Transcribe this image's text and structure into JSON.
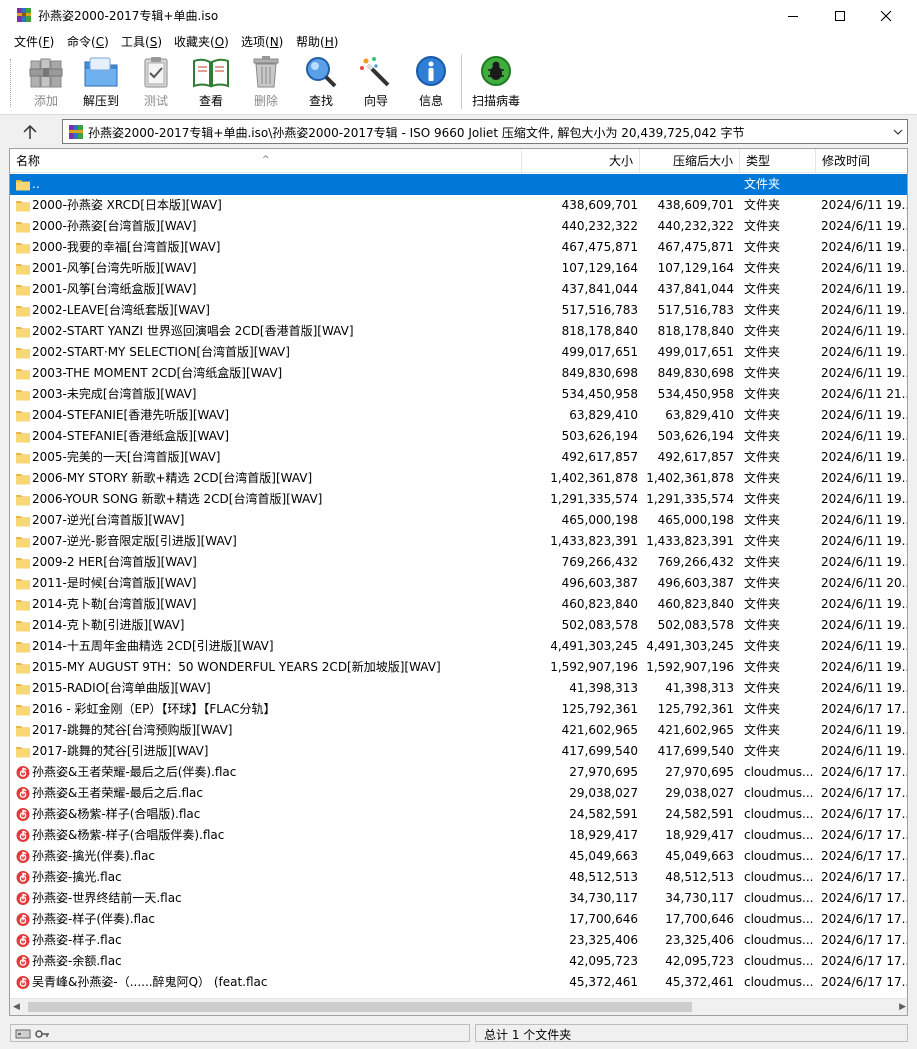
{
  "window": {
    "title": "孙燕姿2000-2017专辑+单曲.iso"
  },
  "menu": [
    {
      "label": "文件(F)",
      "prefix": "文件(",
      "key": "F",
      "suffix": ")"
    },
    {
      "label": "命令(C)",
      "prefix": "命令(",
      "key": "C",
      "suffix": ")"
    },
    {
      "label": "工具(S)",
      "prefix": "工具(",
      "key": "S",
      "suffix": ")"
    },
    {
      "label": "收藏夹(O)",
      "prefix": "收藏夹(",
      "key": "O",
      "suffix": ")"
    },
    {
      "label": "选项(N)",
      "prefix": "选项(",
      "key": "N",
      "suffix": ")"
    },
    {
      "label": "帮助(H)",
      "prefix": "帮助(",
      "key": "H",
      "suffix": ")"
    }
  ],
  "toolbar": {
    "add": "添加",
    "extract": "解压到",
    "test": "测试",
    "view": "查看",
    "delete": "删除",
    "find": "查找",
    "wizard": "向导",
    "info": "信息",
    "scan": "扫描病毒"
  },
  "address": {
    "text": "孙燕姿2000-2017专辑+单曲.iso\\孙燕姿2000-2017专辑 - ISO 9660 Joliet 压缩文件, 解包大小为 20,439,725,042 字节"
  },
  "columns": {
    "name": "名称",
    "size": "大小",
    "packed": "压缩后大小",
    "type": "类型",
    "modified": "修改时间"
  },
  "rows": [
    {
      "name": "..",
      "size": "",
      "packed": "",
      "type": "文件夹",
      "date": "",
      "kind": "folder",
      "selected": true
    },
    {
      "name": "2000-孙燕姿 XRCD[日本版][WAV]",
      "size": "438,609,701",
      "packed": "438,609,701",
      "type": "文件夹",
      "date": "2024/6/11 19...",
      "kind": "folder"
    },
    {
      "name": "2000-孙燕姿[台湾首版][WAV]",
      "size": "440,232,322",
      "packed": "440,232,322",
      "type": "文件夹",
      "date": "2024/6/11 19...",
      "kind": "folder"
    },
    {
      "name": "2000-我要的幸福[台湾首版][WAV]",
      "size": "467,475,871",
      "packed": "467,475,871",
      "type": "文件夹",
      "date": "2024/6/11 19...",
      "kind": "folder"
    },
    {
      "name": "2001-风筝[台湾先听版][WAV]",
      "size": "107,129,164",
      "packed": "107,129,164",
      "type": "文件夹",
      "date": "2024/6/11 19...",
      "kind": "folder"
    },
    {
      "name": "2001-风筝[台湾纸盒版][WAV]",
      "size": "437,841,044",
      "packed": "437,841,044",
      "type": "文件夹",
      "date": "2024/6/11 19...",
      "kind": "folder"
    },
    {
      "name": "2002-LEAVE[台湾纸套版][WAV]",
      "size": "517,516,783",
      "packed": "517,516,783",
      "type": "文件夹",
      "date": "2024/6/11 19...",
      "kind": "folder"
    },
    {
      "name": "2002-START YANZI 世界巡回演唱会 2CD[香港首版][WAV]",
      "size": "818,178,840",
      "packed": "818,178,840",
      "type": "文件夹",
      "date": "2024/6/11 19...",
      "kind": "folder"
    },
    {
      "name": "2002-START·MY SELECTION[台湾首版][WAV]",
      "size": "499,017,651",
      "packed": "499,017,651",
      "type": "文件夹",
      "date": "2024/6/11 19...",
      "kind": "folder"
    },
    {
      "name": "2003-THE MOMENT 2CD[台湾纸盒版][WAV]",
      "size": "849,830,698",
      "packed": "849,830,698",
      "type": "文件夹",
      "date": "2024/6/11 19...",
      "kind": "folder"
    },
    {
      "name": "2003-未完成[台湾首版][WAV]",
      "size": "534,450,958",
      "packed": "534,450,958",
      "type": "文件夹",
      "date": "2024/6/11 21...",
      "kind": "folder"
    },
    {
      "name": "2004-STEFANIE[香港先听版][WAV]",
      "size": "63,829,410",
      "packed": "63,829,410",
      "type": "文件夹",
      "date": "2024/6/11 19...",
      "kind": "folder"
    },
    {
      "name": "2004-STEFANIE[香港纸盒版][WAV]",
      "size": "503,626,194",
      "packed": "503,626,194",
      "type": "文件夹",
      "date": "2024/6/11 19...",
      "kind": "folder"
    },
    {
      "name": "2005-完美的一天[台湾首版][WAV]",
      "size": "492,617,857",
      "packed": "492,617,857",
      "type": "文件夹",
      "date": "2024/6/11 19...",
      "kind": "folder"
    },
    {
      "name": "2006-MY STORY 新歌+精选 2CD[台湾首版][WAV]",
      "size": "1,402,361,878",
      "packed": "1,402,361,878",
      "type": "文件夹",
      "date": "2024/6/11 19...",
      "kind": "folder"
    },
    {
      "name": "2006-YOUR SONG 新歌+精选 2CD[台湾首版][WAV]",
      "size": "1,291,335,574",
      "packed": "1,291,335,574",
      "type": "文件夹",
      "date": "2024/6/11 19...",
      "kind": "folder"
    },
    {
      "name": "2007-逆光[台湾首版][WAV]",
      "size": "465,000,198",
      "packed": "465,000,198",
      "type": "文件夹",
      "date": "2024/6/11 19...",
      "kind": "folder"
    },
    {
      "name": "2007-逆光-影音限定版[引进版][WAV]",
      "size": "1,433,823,391",
      "packed": "1,433,823,391",
      "type": "文件夹",
      "date": "2024/6/11 19...",
      "kind": "folder"
    },
    {
      "name": "2009-2 HER[台湾首版][WAV]",
      "size": "769,266,432",
      "packed": "769,266,432",
      "type": "文件夹",
      "date": "2024/6/11 19...",
      "kind": "folder"
    },
    {
      "name": "2011-是时候[台湾首版][WAV]",
      "size": "496,603,387",
      "packed": "496,603,387",
      "type": "文件夹",
      "date": "2024/6/11 20...",
      "kind": "folder"
    },
    {
      "name": "2014-克卜勒[台湾首版][WAV]",
      "size": "460,823,840",
      "packed": "460,823,840",
      "type": "文件夹",
      "date": "2024/6/11 19...",
      "kind": "folder"
    },
    {
      "name": "2014-克卜勒[引进版][WAV]",
      "size": "502,083,578",
      "packed": "502,083,578",
      "type": "文件夹",
      "date": "2024/6/11 19...",
      "kind": "folder"
    },
    {
      "name": "2014-十五周年金曲精选 2CD[引进版][WAV]",
      "size": "4,491,303,245",
      "packed": "4,491,303,245",
      "type": "文件夹",
      "date": "2024/6/11 19...",
      "kind": "folder"
    },
    {
      "name": "2015-MY AUGUST 9TH：50 WONDERFUL YEARS 2CD[新加坡版][WAV]",
      "size": "1,592,907,196",
      "packed": "1,592,907,196",
      "type": "文件夹",
      "date": "2024/6/11 19...",
      "kind": "folder"
    },
    {
      "name": "2015-RADIO[台湾单曲版][WAV]",
      "size": "41,398,313",
      "packed": "41,398,313",
      "type": "文件夹",
      "date": "2024/6/11 19...",
      "kind": "folder"
    },
    {
      "name": "2016 - 彩虹金刚（EP）【环球】【FLAC分轨】",
      "size": "125,792,361",
      "packed": "125,792,361",
      "type": "文件夹",
      "date": "2024/6/17 17...",
      "kind": "folder"
    },
    {
      "name": "2017-跳舞的梵谷[台湾预购版][WAV]",
      "size": "421,602,965",
      "packed": "421,602,965",
      "type": "文件夹",
      "date": "2024/6/11 19...",
      "kind": "folder"
    },
    {
      "name": "2017-跳舞的梵谷[引进版][WAV]",
      "size": "417,699,540",
      "packed": "417,699,540",
      "type": "文件夹",
      "date": "2024/6/11 19...",
      "kind": "folder"
    },
    {
      "name": "孙燕姿&王者荣耀-最后之后(伴奏).flac",
      "size": "27,970,695",
      "packed": "27,970,695",
      "type": "cloudmus...",
      "date": "2024/6/17 17...",
      "kind": "flac"
    },
    {
      "name": "孙燕姿&王者荣耀-最后之后.flac",
      "size": "29,038,027",
      "packed": "29,038,027",
      "type": "cloudmus...",
      "date": "2024/6/17 17...",
      "kind": "flac"
    },
    {
      "name": "孙燕姿&杨紫-样子(合唱版).flac",
      "size": "24,582,591",
      "packed": "24,582,591",
      "type": "cloudmus...",
      "date": "2024/6/17 17...",
      "kind": "flac"
    },
    {
      "name": "孙燕姿&杨紫-样子(合唱版伴奏).flac",
      "size": "18,929,417",
      "packed": "18,929,417",
      "type": "cloudmus...",
      "date": "2024/6/17 17...",
      "kind": "flac"
    },
    {
      "name": "孙燕姿-擒光(伴奏).flac",
      "size": "45,049,663",
      "packed": "45,049,663",
      "type": "cloudmus...",
      "date": "2024/6/17 17...",
      "kind": "flac"
    },
    {
      "name": "孙燕姿-擒光.flac",
      "size": "48,512,513",
      "packed": "48,512,513",
      "type": "cloudmus...",
      "date": "2024/6/17 17...",
      "kind": "flac"
    },
    {
      "name": "孙燕姿-世界终结前一天.flac",
      "size": "34,730,117",
      "packed": "34,730,117",
      "type": "cloudmus...",
      "date": "2024/6/17 17...",
      "kind": "flac"
    },
    {
      "name": "孙燕姿-样子(伴奏).flac",
      "size": "17,700,646",
      "packed": "17,700,646",
      "type": "cloudmus...",
      "date": "2024/6/17 17...",
      "kind": "flac"
    },
    {
      "name": "孙燕姿-样子.flac",
      "size": "23,325,406",
      "packed": "23,325,406",
      "type": "cloudmus...",
      "date": "2024/6/17 17...",
      "kind": "flac"
    },
    {
      "name": "孙燕姿-余额.flac",
      "size": "42,095,723",
      "packed": "42,095,723",
      "type": "cloudmus...",
      "date": "2024/6/17 17...",
      "kind": "flac"
    },
    {
      "name": "吴青峰&孙燕姿-（......醉鬼阿Q） (feat.flac",
      "size": "45,372,461",
      "packed": "45,372,461",
      "type": "cloudmus...",
      "date": "2024/6/17 17...",
      "kind": "flac"
    }
  ],
  "status": {
    "text": "总计 1 个文件夹"
  },
  "colors": {
    "selection": "#0078d7",
    "folder": "#f8d775",
    "folder_dark": "#e8b84a",
    "flac": "#e03a3a"
  },
  "icons": {
    "app": "winrar-icon",
    "folder": "folder-icon",
    "flac": "netease-music-icon",
    "up": "up-arrow-icon"
  }
}
